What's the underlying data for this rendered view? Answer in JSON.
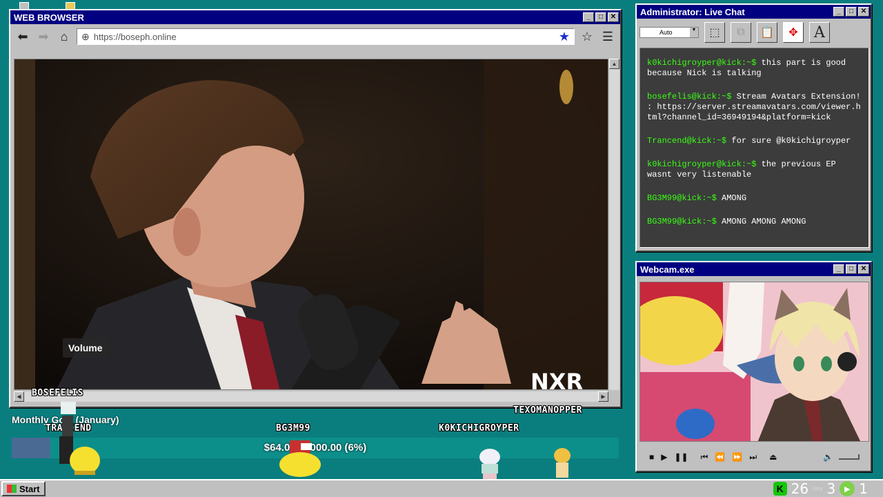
{
  "browser": {
    "title": "WEB BROWSER",
    "url": "https://boseph.online",
    "video": {
      "tooltip": "Volume",
      "logo": "NXR"
    }
  },
  "chat": {
    "title": "Administrator: Live Chat",
    "font_size_select": "Auto",
    "messages": [
      {
        "user": "k0kichigroyper@kick:~$",
        "text": "this part is good because Nick is talking"
      },
      {
        "user": "bosefelis@kick:~$",
        "text": "Stream Avatars Extension! : https://server.streamavatars.com/viewer.html?channel_id=36949194&platform=kick"
      },
      {
        "user": "Trancend@kick:~$",
        "text": "for sure @k0kichigroyper"
      },
      {
        "user": "k0kichigroyper@kick:~$",
        "text": "the previous EP wasnt very listenable"
      },
      {
        "user": "BG3M99@kick:~$",
        "text": "AMONG"
      },
      {
        "user": "BG3M99@kick:~$",
        "text": "AMONG AMONG AMONG"
      }
    ]
  },
  "webcam": {
    "title": "Webcam.exe"
  },
  "goal": {
    "label": "Monthly Goal (January)",
    "text": "$64.00/$1000.00 (6%)",
    "progress": 0.064
  },
  "avatars": {
    "bosefelis": "BOSEFELIS",
    "trancend": "TRANCEND",
    "bg3m99": "BG3M99",
    "kokichi": "K0KICHIGROYPER",
    "texomanopper": "TEXOMANOPPER"
  },
  "taskbar": {
    "start": "Start",
    "count_a": "26",
    "cozy": "cozy",
    "count_b": "3",
    "count_c": "1"
  },
  "colors": {
    "desktop": "#0a7e7e",
    "titlebar": "#000080",
    "chat_user": "#39ff14"
  }
}
